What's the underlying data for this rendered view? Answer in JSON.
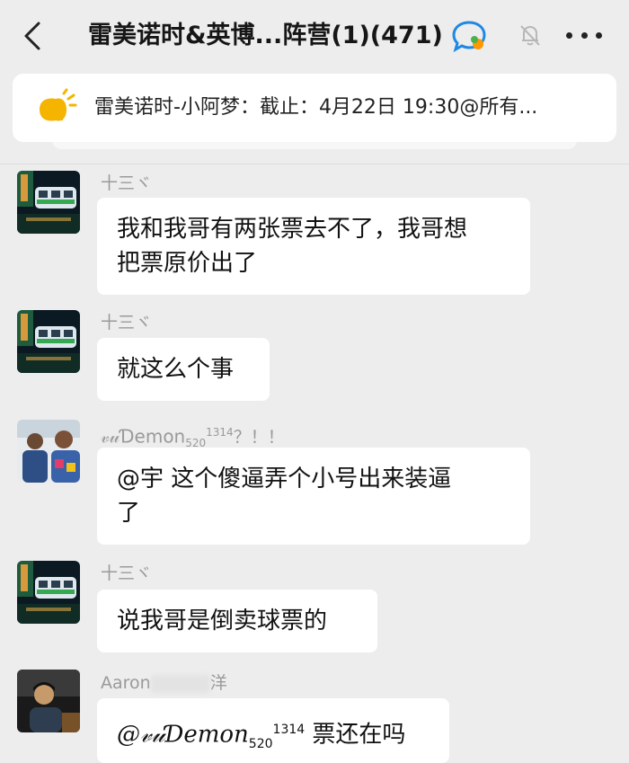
{
  "header": {
    "title": "雷美诺时&英博...阵营(1)(471)"
  },
  "notice": {
    "text": "雷美诺时-小阿梦：截止：4月22日 19:30@所有..."
  },
  "messages": [
    {
      "sender": "十三ヾ",
      "lines": [
        "我和我哥有两张票去不了，我哥想",
        "把票原价出了"
      ]
    },
    {
      "sender": "十三ヾ",
      "lines": [
        "就这么个事"
      ]
    },
    {
      "sender_name": "𝓋𝓊Ɗemon",
      "sender_sub": "520",
      "sender_sup": "1314",
      "sender_suffix": "？！！",
      "lines": [
        "@宇  这个傻逼弄个小号出来装逼",
        "了"
      ]
    },
    {
      "sender": "十三ヾ",
      "lines": [
        "说我哥是倒卖球票的"
      ]
    },
    {
      "sender_name": "Aaron",
      "sender_suffix": "洋",
      "mention": "@𝓋𝓊Ɗemon",
      "mention_sub": "520",
      "mention_sup": "1314",
      "text": " 票还在吗"
    }
  ],
  "colors": {
    "background": "#ededed",
    "bubble": "#ffffff",
    "sender_text": "#9a9a9a",
    "notice_icon": "#f5b400"
  }
}
